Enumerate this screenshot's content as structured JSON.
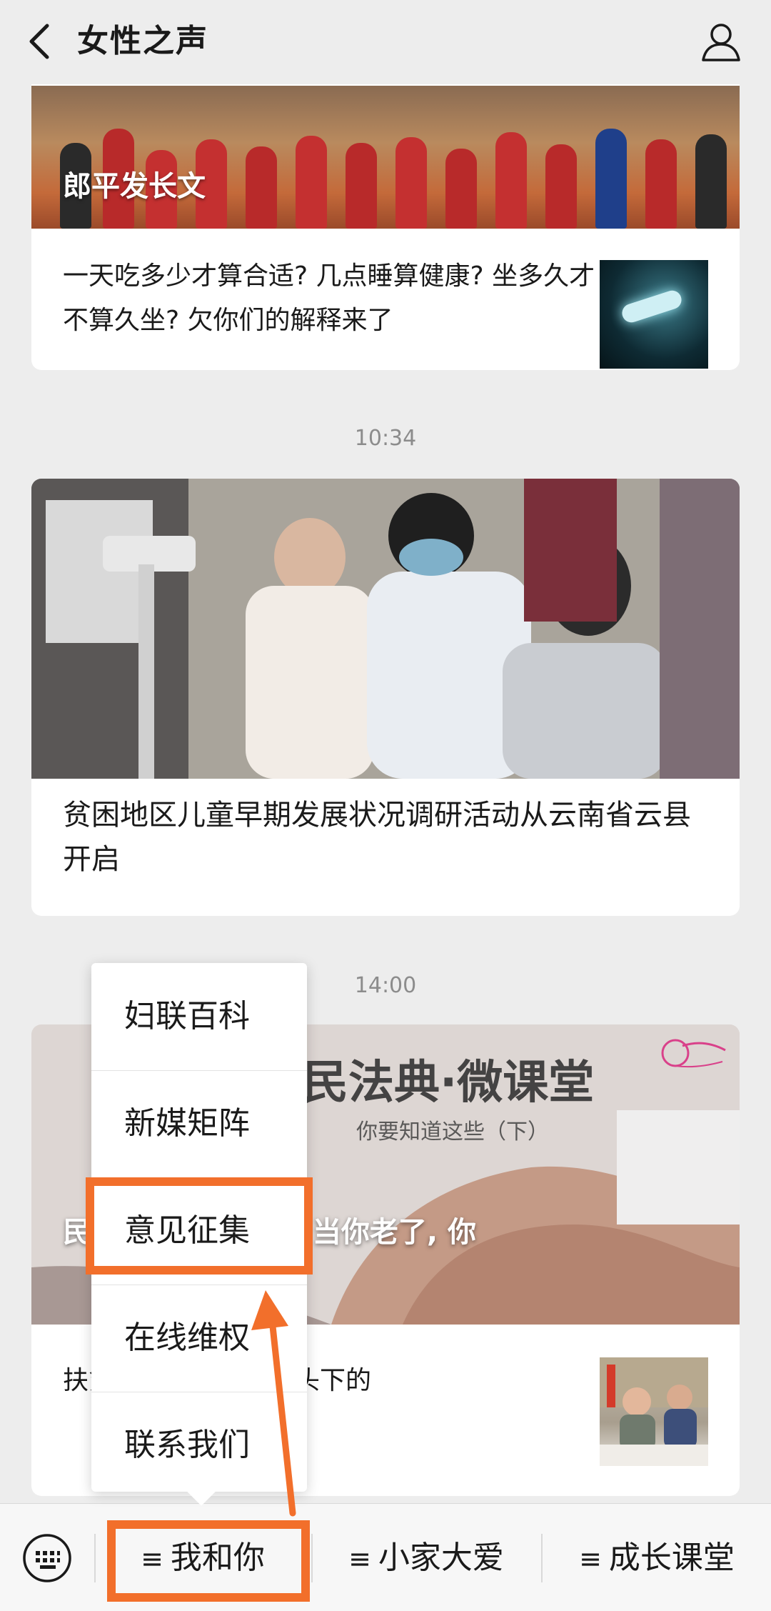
{
  "header": {
    "title": "女性之声"
  },
  "feed": {
    "article1": {
      "banner_caption": "郎平发长文",
      "title": "一天吃多少才算合适? 几点睡算健康? 坐多久才不算久坐? 欠你们的解释来了"
    },
    "timestamp1": "10:34",
    "article2": {
      "title": "贫困地区儿童早期发展状况调研活动从云南省云县开启"
    },
    "timestamp2": "14:00",
    "article3": {
      "banner_text": "民法典·微课堂",
      "banner_subtitle": "你要知道这些（下）",
      "banner_caption": "民法典与你的一生: 当你老了, 你",
      "title": "扶贫第一书记和她镜头下的"
    }
  },
  "popup_menu": {
    "items": [
      {
        "label": "妇联百科"
      },
      {
        "label": "新媒矩阵"
      },
      {
        "label": "意见征集"
      },
      {
        "label": "在线维权"
      },
      {
        "label": "联系我们"
      }
    ]
  },
  "bottom_bar": {
    "tabs": [
      {
        "label": "我和你"
      },
      {
        "label": "小家大爱"
      },
      {
        "label": "成长课堂"
      }
    ]
  },
  "colors": {
    "highlight": "#f26f2b",
    "background": "#ededed"
  }
}
